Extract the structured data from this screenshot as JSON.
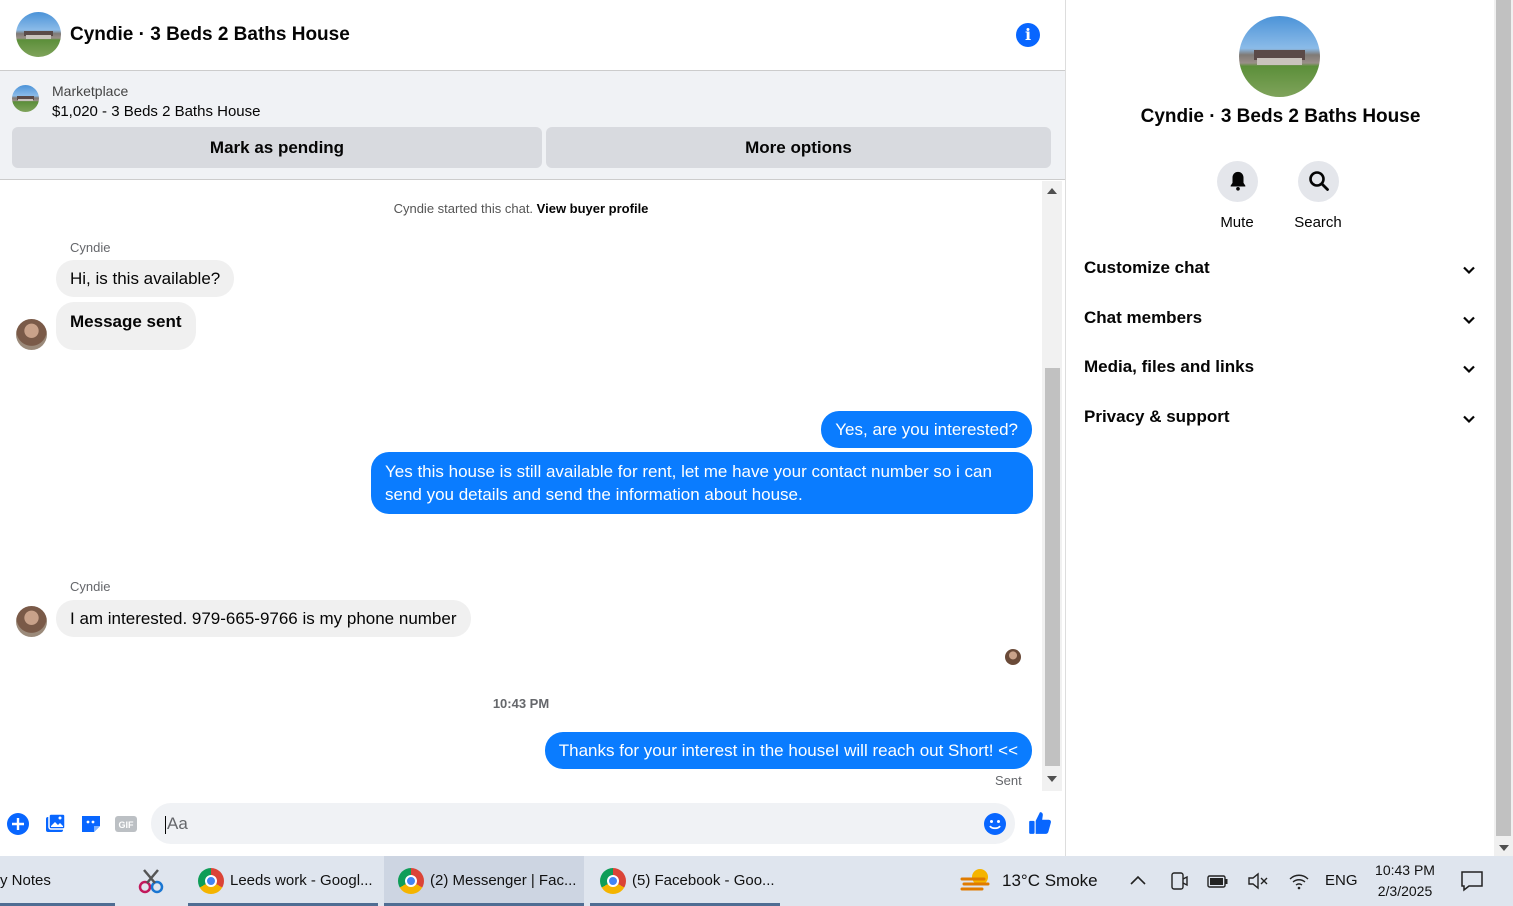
{
  "header": {
    "title": "Cyndie · 3 Beds 2 Baths House",
    "info_icon": "info-icon"
  },
  "marketplace": {
    "label": "Marketplace",
    "listing": "$1,020 - 3 Beds 2 Baths House",
    "mark_pending": "Mark as pending",
    "more_options": "More options"
  },
  "conversation": {
    "started_text": "Cyndie started this chat.",
    "view_profile": "View buyer profile",
    "sender_name_1": "Cyndie",
    "msg_1": "Hi, is this available?",
    "msg_2": "Message sent",
    "msg_3": "Yes, are you interested?",
    "msg_4": "Yes this house is still available for rent, let me have your contact number so i can send you details and send the information about house.",
    "sender_name_2": "Cyndie",
    "msg_5": "I am interested. 979-665-9766 is my phone number",
    "timestamp": "10:43 PM",
    "msg_6": "Thanks for your interest in the houseI will reach out Short! <<",
    "status": "Sent"
  },
  "composer": {
    "placeholder": "Aa"
  },
  "right_panel": {
    "title": "Cyndie · 3 Beds 2 Baths House",
    "mute": "Mute",
    "search": "Search",
    "sections": [
      "Customize chat",
      "Chat members",
      "Media, files and links",
      "Privacy & support"
    ]
  },
  "taskbar": {
    "notes": "y Notes",
    "leeds": "Leeds work - Googl...",
    "messenger": "(2) Messenger | Fac...",
    "facebook": "(5) Facebook - Goo...",
    "weather": "13°C  Smoke",
    "lang": "ENG",
    "time": "10:43 PM",
    "date": "2/3/2025"
  },
  "colors": {
    "accent": "#0866ff",
    "outgoing_bubble": "#0a7cff",
    "incoming_bubble": "#f0f0f0"
  }
}
